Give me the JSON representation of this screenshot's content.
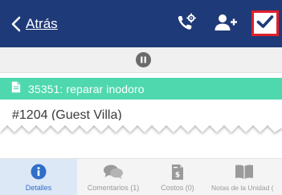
{
  "header": {
    "back_label": "Atrás",
    "icons": {
      "back": "chevron-left-icon",
      "call": "phone-gear-icon",
      "add_user": "add-user-icon",
      "confirm": "checkmark-icon"
    },
    "confirm_highlight_color": "#e01f2b"
  },
  "status": {
    "icon": "pause-icon"
  },
  "work_order": {
    "icon": "document-icon",
    "title": "35351: reparar inodoro",
    "bar_color": "#4fd8ad"
  },
  "unit": {
    "label": "#1204 (Guest Villa)"
  },
  "tabs": [
    {
      "label": "Detalles",
      "icon": "info-icon",
      "active": true
    },
    {
      "label": "Comentarios (1)",
      "icon": "chat-bubbles-icon",
      "active": false
    },
    {
      "label": "Costos (0)",
      "icon": "invoice-dollar-icon",
      "active": false
    },
    {
      "label": "Notas de la Unidad (",
      "icon": "book-icon",
      "active": false
    }
  ],
  "colors": {
    "header_bg": "#1f3a78",
    "accent": "#2f6fc9"
  }
}
